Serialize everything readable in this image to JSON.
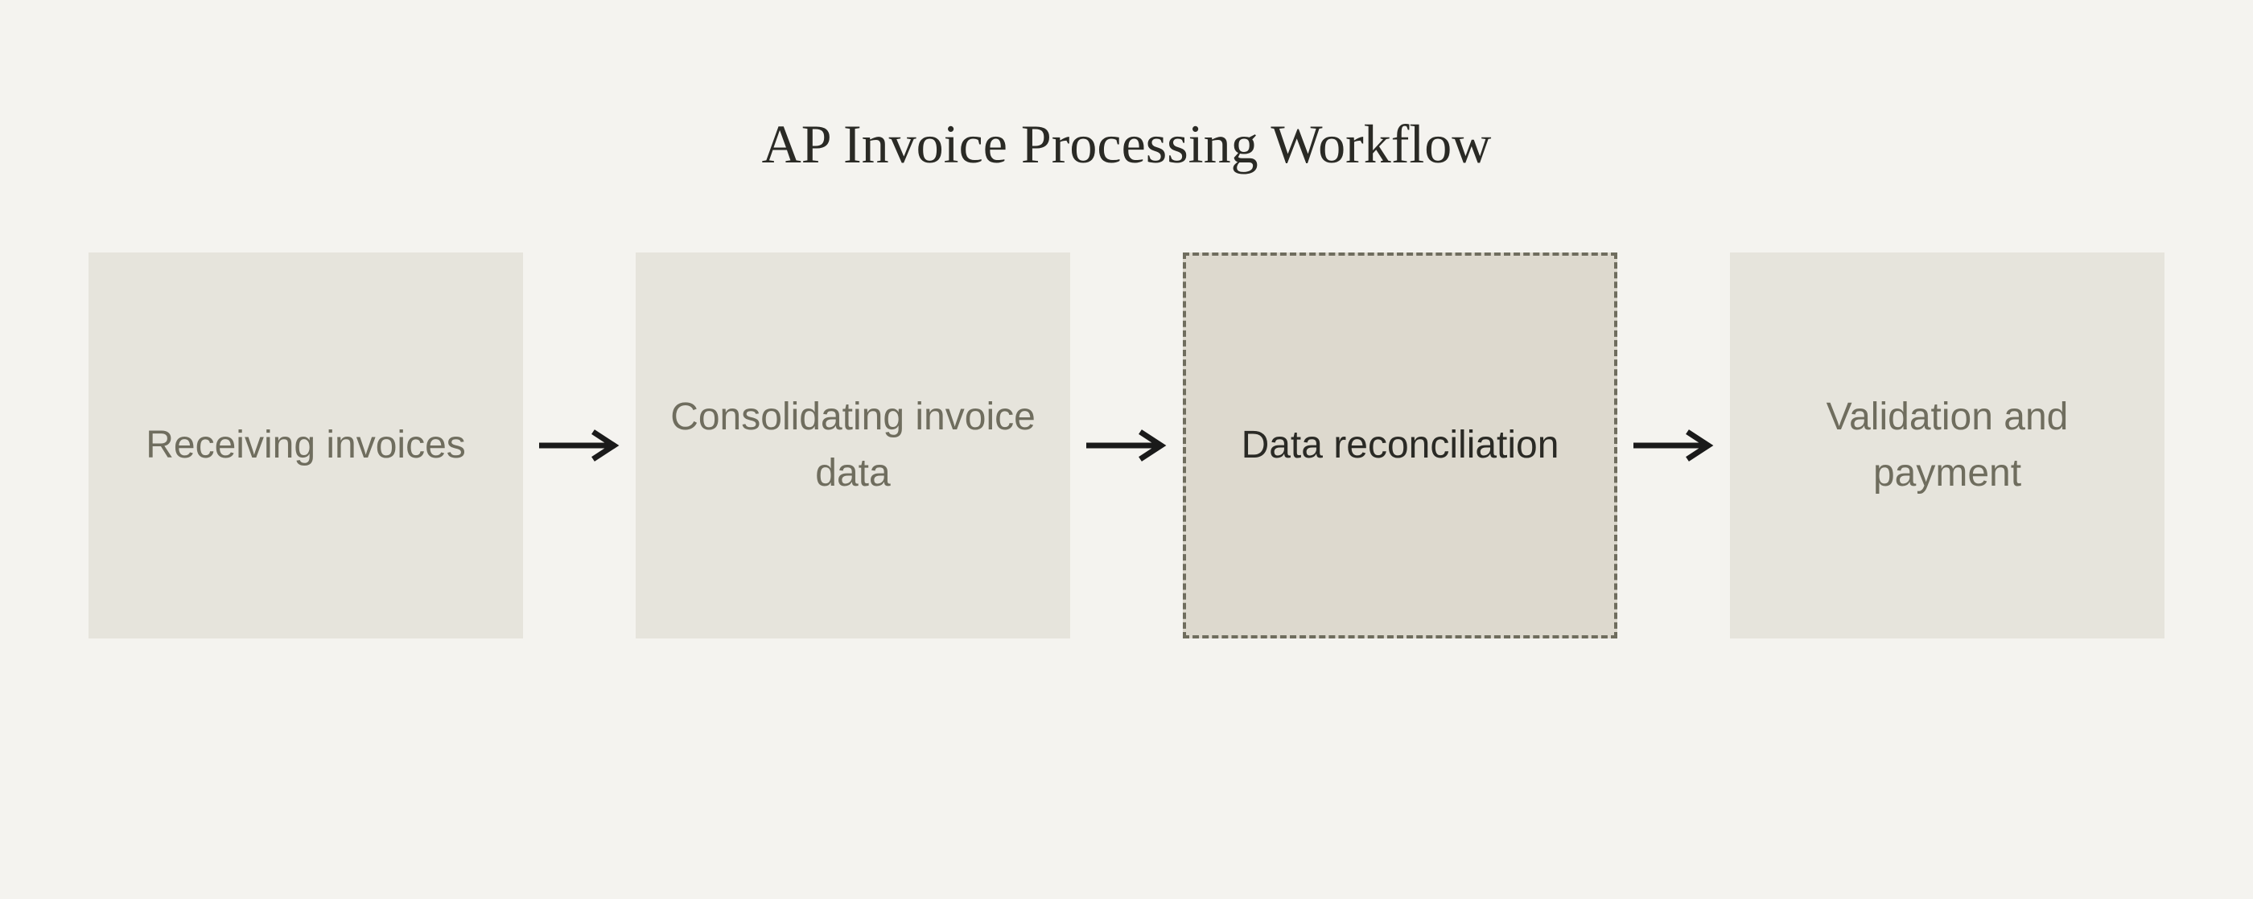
{
  "title": "AP Invoice Processing Workflow",
  "steps": [
    {
      "label": "Receiving invoices",
      "highlighted": false
    },
    {
      "label": "Consolidating invoice data",
      "highlighted": false
    },
    {
      "label": "Data reconciliation",
      "highlighted": true
    },
    {
      "label": "Validation and payment",
      "highlighted": false
    }
  ],
  "colors": {
    "background": "#f4f3ef",
    "step_bg": "#e6e4dc",
    "step_highlight_bg": "#ddd9ce",
    "border_dash": "#6f6d5e",
    "text_muted": "#6f6d5e",
    "text_dark": "#2a2a25",
    "arrow": "#1a1a1a"
  }
}
